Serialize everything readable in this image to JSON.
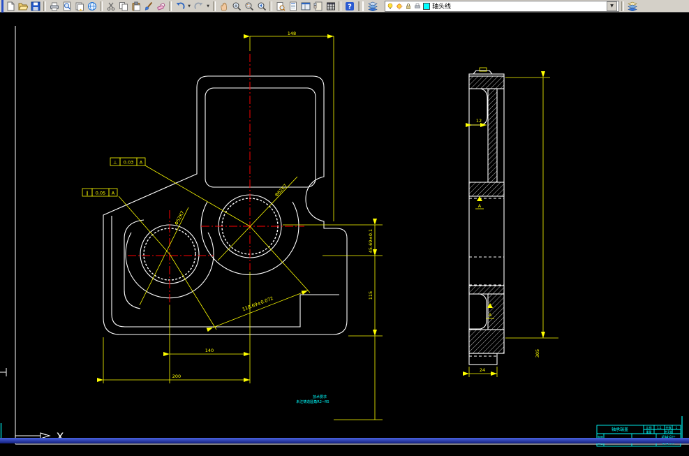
{
  "toolbar": {
    "layer_value": "轴头线",
    "combo_arrow": "▼",
    "icons": [
      "new",
      "open",
      "save",
      "plot",
      "plot-preview",
      "publish",
      "web-publish",
      "cut",
      "copy",
      "paste",
      "match-properties",
      "erase",
      "undo",
      "redo",
      "pan",
      "zoom-realtime",
      "zoom-window",
      "zoom-previous",
      "find",
      "properties",
      "design-center",
      "tool-palettes",
      "sheet-set-manager",
      "help",
      "layers",
      "layer-bulb",
      "layer-freeze",
      "layer-lock",
      "layer-plot",
      "layer-color-swatch",
      "layer-states"
    ]
  },
  "drawing": {
    "dims": {
      "top_width": "148",
      "center_distance": "140",
      "overall_width": "200",
      "center_offset": "45.69±0.1",
      "center_to_base": "115",
      "diagonal_distance": "118.69±0.072",
      "bore_left": "Φ52K7",
      "bore_right": "Φ62K7",
      "side_height": "305",
      "side_tab_width": "24",
      "side_depth": "12"
    },
    "fcf1": {
      "symbol": "⊥",
      "tolerance": "0.03",
      "datum": "A"
    },
    "fcf2": {
      "symbol": "∥",
      "tolerance": "0.05",
      "datum": "A"
    },
    "datum": "A",
    "notes": {
      "line1": "技术要求",
      "line2": "未注铸造圆角R2~R5"
    },
    "ucs_axis": "X"
  },
  "title_block": {
    "part_name": "轴承端盖",
    "scale_label": "比例",
    "scale_value": "1:1",
    "qty_label": "件数",
    "qty_value": "1",
    "weight_label": "重量",
    "sheet_value": "共1张",
    "material_value": "HT150",
    "drawn_label": "制图",
    "checked_label": "审核",
    "org_line1": "机械设计",
    "org_line2": "课程设计"
  },
  "colors": {
    "outline": "#ffffff",
    "dimension": "#ffff00",
    "centerline": "#ff0000",
    "annotation": "#00ffff",
    "toolbar_bg": "#d4d0c8"
  }
}
